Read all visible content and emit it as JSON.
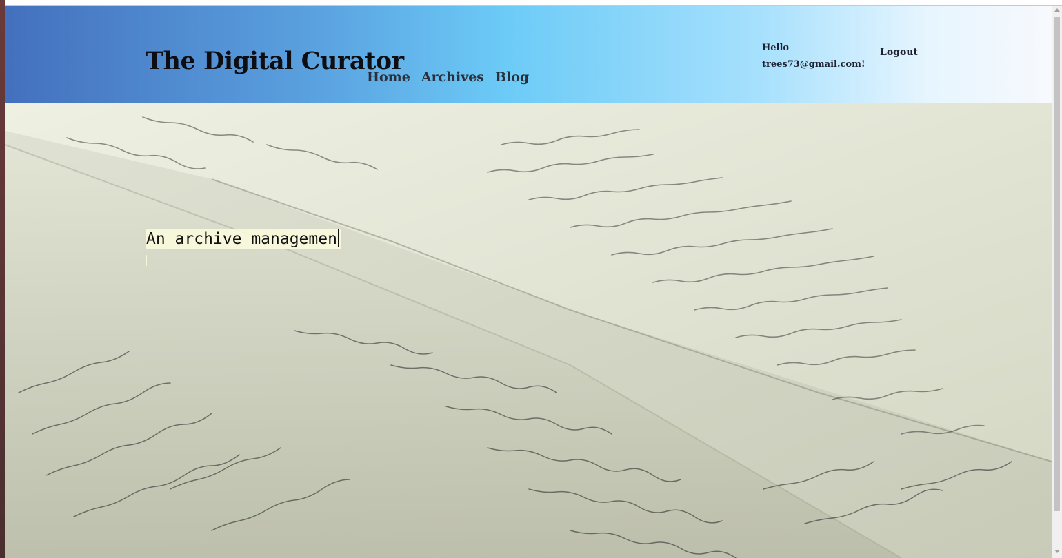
{
  "header": {
    "site_title": "The Digital Curator",
    "nav": [
      {
        "label": "Home"
      },
      {
        "label": "Archives"
      },
      {
        "label": "Blog"
      }
    ],
    "greeting_line1": "Hello",
    "greeting_line2": "trees73@gmail.com!",
    "logout_label": "Logout",
    "gradient_colors": [
      "#4470bd",
      "#6ccbf7",
      "#f7f9fd"
    ]
  },
  "hero": {
    "tagline": "An archive managemen",
    "background": "handwritten-manuscript-pages-photo"
  }
}
